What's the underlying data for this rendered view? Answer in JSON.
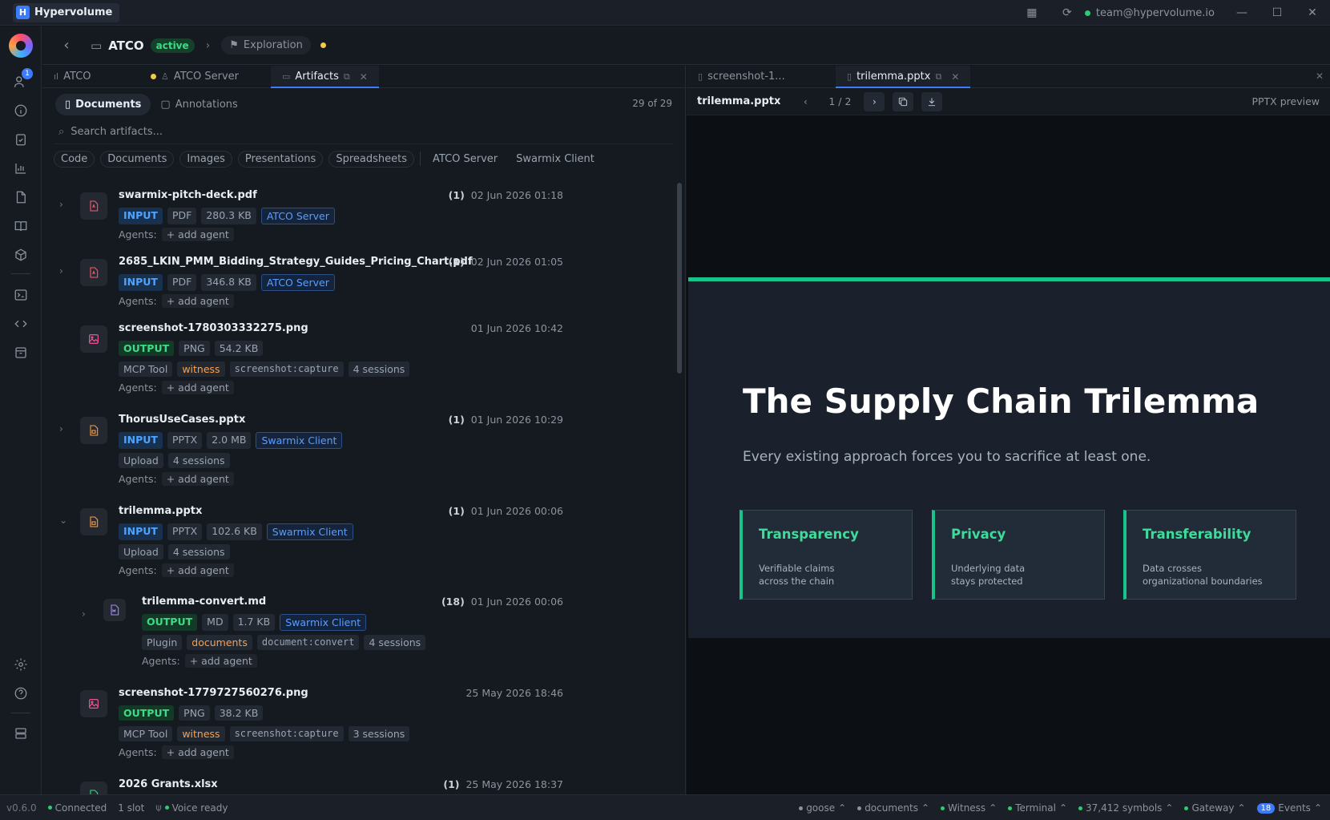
{
  "app": {
    "name": "Hypervolume",
    "logo_letter": "H",
    "user_email": "team@hypervolume.io",
    "version": "v0.6.0"
  },
  "header": {
    "project": "ATCO",
    "status": "active",
    "breadcrumb": "Exploration"
  },
  "sidebar": {
    "notification_count": "1"
  },
  "left_tabs": [
    {
      "label": "ATCO"
    },
    {
      "label": "ATCO Server"
    },
    {
      "label": "Artifacts"
    }
  ],
  "segments": {
    "documents": "Documents",
    "annotations": "Annotations",
    "count": "29 of 29"
  },
  "search": {
    "placeholder": "Search artifacts..."
  },
  "filters": [
    "Code",
    "Documents",
    "Images",
    "Presentations",
    "Spreadsheets",
    "ATCO Server",
    "Swarmix Client"
  ],
  "agents_label": "Agents:",
  "add_agent": "+ add agent",
  "artifacts": [
    {
      "name": "swarmix-pitch-deck.pdf",
      "count": "(1)",
      "date": "02 Jun 2026 01:18",
      "dir": "INPUT",
      "type": "PDF",
      "size": "280.3 KB",
      "source": "ATCO Server"
    },
    {
      "name": "2685_LKIN_PMM_Bidding_Strategy_Guides_Pricing_Chart.pdf",
      "count": "(1)",
      "date": "02 Jun 2026 01:05",
      "dir": "INPUT",
      "type": "PDF",
      "size": "346.8 KB",
      "source": "ATCO Server"
    },
    {
      "name": "screenshot-1780303332275.png",
      "date": "01 Jun 2026 10:42",
      "dir": "OUTPUT",
      "type": "PNG",
      "size": "54.2 KB",
      "origin": "MCP Tool",
      "agent": "witness",
      "tool": "screenshot:capture",
      "sessions": "4 sessions"
    },
    {
      "name": "ThorusUseCases.pptx",
      "count": "(1)",
      "date": "01 Jun 2026 10:29",
      "dir": "INPUT",
      "type": "PPTX",
      "size": "2.0 MB",
      "source": "Swarmix Client",
      "origin": "Upload",
      "sessions": "4 sessions"
    },
    {
      "name": "trilemma.pptx",
      "count": "(1)",
      "date": "01 Jun 2026 00:06",
      "dir": "INPUT",
      "type": "PPTX",
      "size": "102.6 KB",
      "source": "Swarmix Client",
      "origin": "Upload",
      "sessions": "4 sessions"
    },
    {
      "name": "trilemma-convert.md",
      "count": "(18)",
      "date": "01 Jun 2026 00:06",
      "dir": "OUTPUT",
      "type": "MD",
      "size": "1.7 KB",
      "source": "Swarmix Client",
      "origin": "Plugin",
      "agent": "documents",
      "tool": "document:convert",
      "sessions": "4 sessions"
    },
    {
      "name": "screenshot-1779727560276.png",
      "date": "25 May 2026 18:46",
      "dir": "OUTPUT",
      "type": "PNG",
      "size": "38.2 KB",
      "origin": "MCP Tool",
      "agent": "witness",
      "tool": "screenshot:capture",
      "sessions": "3 sessions"
    },
    {
      "name": "2026 Grants.xlsx",
      "count": "(1)",
      "date": "25 May 2026 18:37"
    }
  ],
  "right_tabs": [
    {
      "label": "screenshot-1..."
    },
    {
      "label": "trilemma.pptx"
    }
  ],
  "preview": {
    "filename": "trilemma.pptx",
    "page": "1 / 2",
    "label": "PPTX preview",
    "slide": {
      "title": "The Supply Chain Trilemma",
      "subtitle": "Every existing approach forces you to sacrifice at least one.",
      "cards": [
        {
          "title": "Transparency",
          "text1": "Verifiable claims",
          "text2": "across the chain"
        },
        {
          "title": "Privacy",
          "text1": "Underlying data",
          "text2": "stays protected"
        },
        {
          "title": "Transferability",
          "text1": "Data crosses",
          "text2": "organizational boundaries"
        }
      ]
    }
  },
  "status": {
    "connected": "Connected",
    "slot": "1 slot",
    "voice": "Voice ready",
    "items": [
      "goose",
      "documents",
      "Witness",
      "Terminal",
      "37,412 symbols",
      "Gateway"
    ],
    "events_count": "18",
    "events_label": "Events"
  },
  "colors": {
    "accent": "#3d7bfd",
    "green": "#3ddc84",
    "orange": "#ff9f43",
    "slide_accent": "#18c489"
  }
}
